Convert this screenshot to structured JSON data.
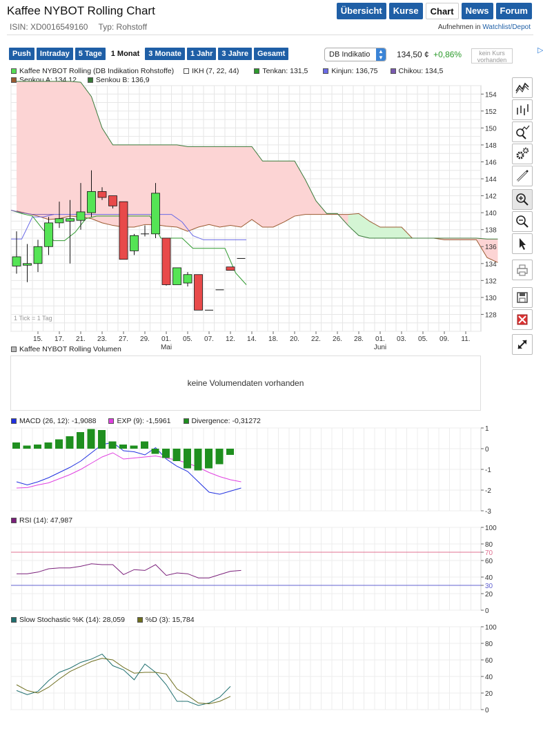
{
  "header": {
    "title": "Kaffee NYBOT Rolling Chart",
    "isin": "ISIN: XD0016549160",
    "type": "Typ: Rohstoff",
    "nav": [
      "Übersicht",
      "Kurse",
      "Chart",
      "News",
      "Forum"
    ],
    "nav_active": "Chart",
    "watchlist_prefix": "Aufnehmen in",
    "watchlist_link": "Watchlist/Depot"
  },
  "toolbar": {
    "periods": [
      "Push",
      "Intraday",
      "5 Tage",
      "1 Monat",
      "3 Monate",
      "1 Jahr",
      "3 Jahre",
      "Gesamt"
    ],
    "period_active": "1 Monat",
    "exchange": "DB Indikatio",
    "price": "134,50 ¢",
    "change": "+0,86%",
    "no_quote": "kein Kurs vorhanden",
    "ad_icon": "ad-choices-icon"
  },
  "main_legend": {
    "row1": [
      {
        "label": "Kaffee NYBOT Rolling (DB Indikation Rohstoffe)",
        "color": "#55dd55"
      },
      {
        "label": "IKH (7, 22, 44)",
        "color": "#ffffff"
      },
      {
        "label": "Tenkan: 131,5",
        "color": "#2e9a2e"
      },
      {
        "label": "Kinjun: 136,75",
        "color": "#6a6ae6"
      },
      {
        "label": "Chikou: 134,5",
        "color": "#7a5ab0"
      }
    ],
    "row2": [
      {
        "label": "Senkou A: 134,12",
        "color": "#9a5a30"
      },
      {
        "label": "Senkou B: 136,9",
        "color": "#3a7a3a"
      }
    ],
    "tick_note": "1 Tick = 1 Tag"
  },
  "chart_data": [
    {
      "type": "candlestick",
      "title": "Kaffee NYBOT Rolling",
      "ylim": [
        126,
        155
      ],
      "yticks": [
        128,
        130,
        132,
        134,
        136,
        138,
        140,
        142,
        144,
        146,
        148,
        150,
        152,
        154
      ],
      "x_tick_labels": [
        "15.",
        "17.",
        "21.",
        "23.",
        "27.",
        "29.",
        "01.",
        "05.",
        "07.",
        "12.",
        "14.",
        "18.",
        "20.",
        "22.",
        "26.",
        "28.",
        "01.",
        "03.",
        "05.",
        "09.",
        "11."
      ],
      "month_labels": [
        {
          "label": "Mai",
          "at_tick": 6
        },
        {
          "label": "Juni",
          "at_tick": 16
        }
      ],
      "candles": [
        {
          "o": 133.7,
          "h": 137.8,
          "l": 132.8,
          "c": 134.8
        },
        {
          "o": 133.8,
          "h": 136.3,
          "l": 131.8,
          "c": 134.0
        },
        {
          "o": 134.0,
          "h": 136.8,
          "l": 133.0,
          "c": 136.0
        },
        {
          "o": 136.0,
          "h": 139.5,
          "l": 135.0,
          "c": 138.8
        },
        {
          "o": 138.8,
          "h": 141.3,
          "l": 138.2,
          "c": 139.3
        },
        {
          "o": 139.0,
          "h": 141.5,
          "l": 134.0,
          "c": 139.3
        },
        {
          "o": 139.1,
          "h": 143.5,
          "l": 138.0,
          "c": 140.1
        },
        {
          "o": 140.0,
          "h": 145.0,
          "l": 139.5,
          "c": 142.5
        },
        {
          "o": 142.5,
          "h": 143.0,
          "l": 141.5,
          "c": 141.8
        },
        {
          "o": 142.0,
          "h": 142.0,
          "l": 140.5,
          "c": 140.8
        },
        {
          "o": 141.3,
          "h": 141.3,
          "l": 134.5,
          "c": 134.5
        },
        {
          "o": 135.5,
          "h": 137.5,
          "l": 135.0,
          "c": 137.3
        },
        {
          "o": 137.5,
          "h": 138.5,
          "l": 137.2,
          "c": 137.5
        },
        {
          "o": 137.5,
          "h": 143.5,
          "l": 137.0,
          "c": 142.3
        },
        {
          "o": 137.0,
          "h": 137.0,
          "l": 131.4,
          "c": 131.5
        },
        {
          "o": 131.5,
          "h": 133.5,
          "l": 131.5,
          "c": 133.5
        },
        {
          "o": 131.7,
          "h": 133.0,
          "l": 131.3,
          "c": 132.7
        },
        {
          "o": 132.7,
          "h": 132.7,
          "l": 128.5,
          "c": 128.5
        },
        {
          "o": 128.5,
          "h": 128.5,
          "l": 128.5,
          "c": 128.5
        },
        {
          "o": 130.9,
          "h": 130.9,
          "l": 130.9,
          "c": 130.9
        },
        {
          "o": 133.6,
          "h": 133.6,
          "l": 133.2,
          "c": 133.2
        },
        {
          "o": 134.6,
          "h": 134.6,
          "l": 134.6,
          "c": 134.6
        }
      ],
      "tenkan": [
        140.3,
        139.9,
        139.6,
        138.0,
        136.7,
        136.7,
        137.7,
        139.3,
        139.6,
        139.6,
        139.6,
        139.6,
        139.6,
        139.6,
        137.0,
        137.0,
        137.0,
        135.8,
        135.8,
        135.8,
        135.8,
        132.9,
        131.5
      ],
      "kinjun": [
        136.9,
        136.9,
        139.5,
        139.5,
        139.8,
        139.8,
        139.8,
        139.8,
        139.8,
        139.8,
        139.8,
        139.8,
        139.8,
        139.8,
        139.8,
        139.8,
        138.9,
        137.3,
        136.8,
        136.8,
        136.8,
        136.8,
        136.8
      ],
      "chikou": [
        140.3,
        140.0,
        139.8,
        139.8,
        139.8
      ],
      "senkou_a": [
        140.2,
        139.9,
        139.6,
        139.2,
        139.3,
        139.6,
        139.5,
        139.3,
        138.8,
        138.5,
        138.3,
        138.3,
        138.6,
        138.6,
        138.4,
        138.3,
        137.8,
        138.3,
        138.6,
        138.3,
        138.5,
        138.3,
        139.2,
        138.3,
        138.3,
        138.9,
        139.6,
        139.8,
        139.8,
        139.8,
        139.8,
        139.8,
        139.9,
        139.0,
        138.3,
        138.3,
        138.3,
        137.0,
        137.0,
        137.0,
        136.8,
        136.8,
        136.8,
        136.8,
        134.7,
        134.12
      ],
      "senkou_b": [
        155.5,
        155.5,
        155.5,
        155.5,
        155.5,
        155.5,
        155.4,
        153.7,
        150.0,
        148.0,
        148.0,
        148.0,
        148.0,
        148.0,
        148.0,
        148.0,
        147.8,
        147.8,
        147.8,
        147.8,
        147.8,
        147.8,
        147.8,
        146.1,
        146.1,
        146.1,
        146.1,
        143.9,
        141.4,
        139.9,
        139.9,
        138.5,
        137.3,
        137.0,
        137.0,
        137.0,
        137.0,
        137.0,
        137.0,
        137.0,
        137.0,
        137.0,
        137.0,
        137.0,
        136.9,
        136.9
      ]
    },
    {
      "type": "line",
      "title": "MACD",
      "ylim": [
        -3,
        1
      ],
      "yticks": [
        -3,
        -2,
        -1,
        0,
        1
      ],
      "series": [
        {
          "name": "MACD (26, 12): -1,9088",
          "color": "#2030e0",
          "values": [
            -1.6,
            -1.75,
            -1.6,
            -1.4,
            -1.15,
            -0.9,
            -0.6,
            -0.2,
            0.2,
            0.3,
            -0.1,
            -0.15,
            -0.3,
            0.05,
            -0.5,
            -0.85,
            -1.1,
            -1.6,
            -2.1,
            -2.2,
            -2.05,
            -1.9
          ]
        },
        {
          "name": "EXP (9): -1,5961",
          "color": "#e040e0",
          "values": [
            -1.9,
            -1.88,
            -1.75,
            -1.65,
            -1.45,
            -1.25,
            -1.0,
            -0.7,
            -0.4,
            -0.2,
            -0.5,
            -0.45,
            -0.4,
            -0.35,
            -0.45,
            -0.55,
            -0.7,
            -0.9,
            -1.15,
            -1.35,
            -1.5,
            -1.6
          ]
        },
        {
          "name": "Divergence: -0,31272",
          "color": "#1f8f1f",
          "type": "bar",
          "values": [
            0.3,
            0.15,
            0.2,
            0.3,
            0.45,
            0.6,
            0.8,
            0.95,
            0.9,
            0.35,
            0.2,
            0.15,
            0.35,
            -0.25,
            -0.45,
            -0.6,
            -0.95,
            -1.05,
            -0.95,
            -0.75,
            -0.3
          ]
        }
      ]
    },
    {
      "type": "line",
      "title": "RSI",
      "ylim": [
        0,
        100
      ],
      "yticks": [
        0,
        20,
        30,
        40,
        60,
        70,
        80,
        100
      ],
      "reference_lines": [
        70,
        30
      ],
      "series": [
        {
          "name": "RSI (14): 47,987",
          "color": "#7a1f7a",
          "values": [
            44,
            44,
            46,
            50,
            51,
            51,
            53,
            56,
            55,
            55,
            43,
            49,
            48,
            55,
            42,
            45,
            44,
            39,
            39,
            43,
            47,
            48
          ]
        }
      ]
    },
    {
      "type": "line",
      "title": "Slow Stochastic",
      "ylim": [
        0,
        100
      ],
      "yticks": [
        0,
        20,
        40,
        60,
        80,
        100
      ],
      "series": [
        {
          "name": "Slow Stochastic %K (14): 28,059",
          "color": "#1f6f6f",
          "values": [
            23,
            18,
            22,
            35,
            45,
            50,
            57,
            61,
            67,
            53,
            48,
            36,
            55,
            45,
            30,
            10,
            10,
            5,
            8,
            15,
            28
          ]
        },
        {
          "name": "%D (3): 15,784",
          "color": "#6f6f1f",
          "values": [
            30,
            23,
            20,
            27,
            37,
            46,
            52,
            58,
            62,
            60,
            51,
            44,
            45,
            45,
            43,
            25,
            17,
            8,
            7,
            10,
            16
          ]
        }
      ]
    }
  ],
  "volume": {
    "legend": "Kaffee NYBOT Rolling Volumen",
    "empty_text": "keine Volumendaten vorhanden"
  },
  "indicator_legends": {
    "macd": [
      {
        "label": "MACD (26, 12): -1,9088",
        "color": "#2030e0"
      },
      {
        "label": "EXP (9): -1,5961",
        "color": "#e040e0"
      },
      {
        "label": "Divergence: -0,31272",
        "color": "#1f8f1f"
      }
    ],
    "rsi": [
      {
        "label": "RSI (14): 47,987",
        "color": "#7a1f7a"
      }
    ],
    "sto": [
      {
        "label": "Slow Stochastic %K (14): 28,059",
        "color": "#1f6f6f"
      },
      {
        "label": "%D (3): 15,784",
        "color": "#6f6f1f"
      }
    ]
  },
  "sidebar_tools": [
    "line-chart-icon",
    "ohlc-chart-icon",
    "indicator-settings-icon",
    "settings-gears-icon",
    "draw-pen-icon",
    "zoom-in-icon",
    "zoom-out-icon",
    "pointer-icon",
    "print-icon",
    "save-icon",
    "delete-icon",
    "fullscreen-icon"
  ]
}
